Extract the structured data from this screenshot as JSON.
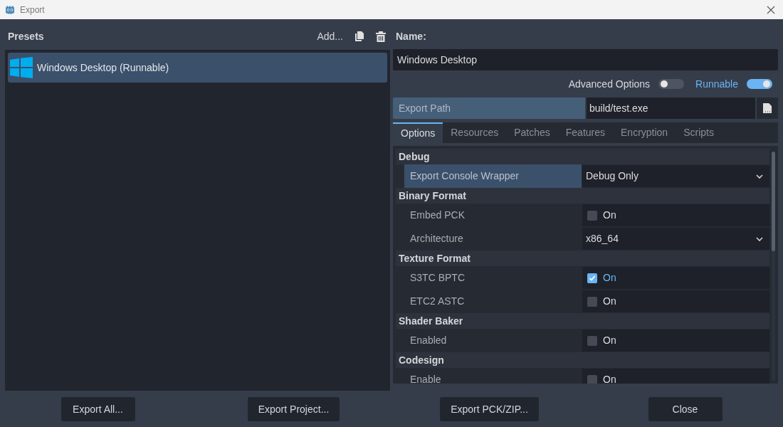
{
  "window": {
    "title": "Export"
  },
  "presets": {
    "title": "Presets",
    "add_label": "Add...",
    "items": [
      {
        "label": "Windows Desktop (Runnable)",
        "selected": true
      }
    ]
  },
  "name": {
    "label": "Name:",
    "value": "Windows Desktop"
  },
  "toggles": [
    {
      "label": "Advanced Options",
      "on": false
    },
    {
      "label": "Runnable",
      "on": true
    }
  ],
  "export_path": {
    "label": "Export Path",
    "value": "build/test.exe"
  },
  "tabs": [
    {
      "label": "Options",
      "selected": true
    },
    {
      "label": "Resources",
      "selected": false
    },
    {
      "label": "Patches",
      "selected": false
    },
    {
      "label": "Features",
      "selected": false
    },
    {
      "label": "Encryption",
      "selected": false
    },
    {
      "label": "Scripts",
      "selected": false
    }
  ],
  "sections": [
    {
      "title": "Debug",
      "properties": [
        {
          "kind": "dropdown",
          "label": "Export Console Wrapper",
          "value": "Debug Only",
          "selected": true
        }
      ]
    },
    {
      "title": "Binary Format",
      "properties": [
        {
          "kind": "checkbox",
          "label": "Embed PCK",
          "value": "On",
          "checked": false,
          "selected": false
        },
        {
          "kind": "dropdown",
          "label": "Architecture",
          "value": "x86_64",
          "selected": false
        }
      ]
    },
    {
      "title": "Texture Format",
      "properties": [
        {
          "kind": "checkbox",
          "label": "S3TC BPTC",
          "value": "On",
          "checked": true,
          "selected": false
        },
        {
          "kind": "checkbox",
          "label": "ETC2 ASTC",
          "value": "On",
          "checked": false,
          "selected": false
        }
      ]
    },
    {
      "title": "Shader Baker",
      "properties": [
        {
          "kind": "checkbox",
          "label": "Enabled",
          "value": "On",
          "checked": false,
          "selected": false
        }
      ]
    },
    {
      "title": "Codesign",
      "properties": [
        {
          "kind": "checkbox",
          "label": "Enable",
          "value": "On",
          "checked": false,
          "selected": false
        }
      ]
    }
  ],
  "buttons": [
    "Export All...",
    "Export Project...",
    "Export PCK/ZIP...",
    "Close"
  ]
}
